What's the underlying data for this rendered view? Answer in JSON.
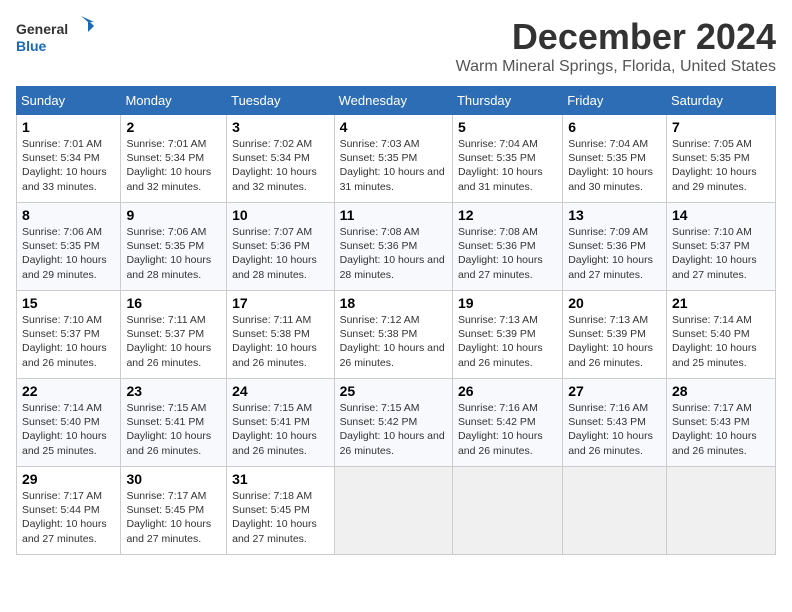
{
  "logo": {
    "line1": "General",
    "line2": "Blue"
  },
  "title": "December 2024",
  "subtitle": "Warm Mineral Springs, Florida, United States",
  "headers": [
    "Sunday",
    "Monday",
    "Tuesday",
    "Wednesday",
    "Thursday",
    "Friday",
    "Saturday"
  ],
  "weeks": [
    [
      {
        "day": "1",
        "sunrise": "Sunrise: 7:01 AM",
        "sunset": "Sunset: 5:34 PM",
        "daylight": "Daylight: 10 hours and 33 minutes."
      },
      {
        "day": "2",
        "sunrise": "Sunrise: 7:01 AM",
        "sunset": "Sunset: 5:34 PM",
        "daylight": "Daylight: 10 hours and 32 minutes."
      },
      {
        "day": "3",
        "sunrise": "Sunrise: 7:02 AM",
        "sunset": "Sunset: 5:34 PM",
        "daylight": "Daylight: 10 hours and 32 minutes."
      },
      {
        "day": "4",
        "sunrise": "Sunrise: 7:03 AM",
        "sunset": "Sunset: 5:35 PM",
        "daylight": "Daylight: 10 hours and 31 minutes."
      },
      {
        "day": "5",
        "sunrise": "Sunrise: 7:04 AM",
        "sunset": "Sunset: 5:35 PM",
        "daylight": "Daylight: 10 hours and 31 minutes."
      },
      {
        "day": "6",
        "sunrise": "Sunrise: 7:04 AM",
        "sunset": "Sunset: 5:35 PM",
        "daylight": "Daylight: 10 hours and 30 minutes."
      },
      {
        "day": "7",
        "sunrise": "Sunrise: 7:05 AM",
        "sunset": "Sunset: 5:35 PM",
        "daylight": "Daylight: 10 hours and 29 minutes."
      }
    ],
    [
      {
        "day": "8",
        "sunrise": "Sunrise: 7:06 AM",
        "sunset": "Sunset: 5:35 PM",
        "daylight": "Daylight: 10 hours and 29 minutes."
      },
      {
        "day": "9",
        "sunrise": "Sunrise: 7:06 AM",
        "sunset": "Sunset: 5:35 PM",
        "daylight": "Daylight: 10 hours and 28 minutes."
      },
      {
        "day": "10",
        "sunrise": "Sunrise: 7:07 AM",
        "sunset": "Sunset: 5:36 PM",
        "daylight": "Daylight: 10 hours and 28 minutes."
      },
      {
        "day": "11",
        "sunrise": "Sunrise: 7:08 AM",
        "sunset": "Sunset: 5:36 PM",
        "daylight": "Daylight: 10 hours and 28 minutes."
      },
      {
        "day": "12",
        "sunrise": "Sunrise: 7:08 AM",
        "sunset": "Sunset: 5:36 PM",
        "daylight": "Daylight: 10 hours and 27 minutes."
      },
      {
        "day": "13",
        "sunrise": "Sunrise: 7:09 AM",
        "sunset": "Sunset: 5:36 PM",
        "daylight": "Daylight: 10 hours and 27 minutes."
      },
      {
        "day": "14",
        "sunrise": "Sunrise: 7:10 AM",
        "sunset": "Sunset: 5:37 PM",
        "daylight": "Daylight: 10 hours and 27 minutes."
      }
    ],
    [
      {
        "day": "15",
        "sunrise": "Sunrise: 7:10 AM",
        "sunset": "Sunset: 5:37 PM",
        "daylight": "Daylight: 10 hours and 26 minutes."
      },
      {
        "day": "16",
        "sunrise": "Sunrise: 7:11 AM",
        "sunset": "Sunset: 5:37 PM",
        "daylight": "Daylight: 10 hours and 26 minutes."
      },
      {
        "day": "17",
        "sunrise": "Sunrise: 7:11 AM",
        "sunset": "Sunset: 5:38 PM",
        "daylight": "Daylight: 10 hours and 26 minutes."
      },
      {
        "day": "18",
        "sunrise": "Sunrise: 7:12 AM",
        "sunset": "Sunset: 5:38 PM",
        "daylight": "Daylight: 10 hours and 26 minutes."
      },
      {
        "day": "19",
        "sunrise": "Sunrise: 7:13 AM",
        "sunset": "Sunset: 5:39 PM",
        "daylight": "Daylight: 10 hours and 26 minutes."
      },
      {
        "day": "20",
        "sunrise": "Sunrise: 7:13 AM",
        "sunset": "Sunset: 5:39 PM",
        "daylight": "Daylight: 10 hours and 26 minutes."
      },
      {
        "day": "21",
        "sunrise": "Sunrise: 7:14 AM",
        "sunset": "Sunset: 5:40 PM",
        "daylight": "Daylight: 10 hours and 25 minutes."
      }
    ],
    [
      {
        "day": "22",
        "sunrise": "Sunrise: 7:14 AM",
        "sunset": "Sunset: 5:40 PM",
        "daylight": "Daylight: 10 hours and 25 minutes."
      },
      {
        "day": "23",
        "sunrise": "Sunrise: 7:15 AM",
        "sunset": "Sunset: 5:41 PM",
        "daylight": "Daylight: 10 hours and 26 minutes."
      },
      {
        "day": "24",
        "sunrise": "Sunrise: 7:15 AM",
        "sunset": "Sunset: 5:41 PM",
        "daylight": "Daylight: 10 hours and 26 minutes."
      },
      {
        "day": "25",
        "sunrise": "Sunrise: 7:15 AM",
        "sunset": "Sunset: 5:42 PM",
        "daylight": "Daylight: 10 hours and 26 minutes."
      },
      {
        "day": "26",
        "sunrise": "Sunrise: 7:16 AM",
        "sunset": "Sunset: 5:42 PM",
        "daylight": "Daylight: 10 hours and 26 minutes."
      },
      {
        "day": "27",
        "sunrise": "Sunrise: 7:16 AM",
        "sunset": "Sunset: 5:43 PM",
        "daylight": "Daylight: 10 hours and 26 minutes."
      },
      {
        "day": "28",
        "sunrise": "Sunrise: 7:17 AM",
        "sunset": "Sunset: 5:43 PM",
        "daylight": "Daylight: 10 hours and 26 minutes."
      }
    ],
    [
      {
        "day": "29",
        "sunrise": "Sunrise: 7:17 AM",
        "sunset": "Sunset: 5:44 PM",
        "daylight": "Daylight: 10 hours and 27 minutes."
      },
      {
        "day": "30",
        "sunrise": "Sunrise: 7:17 AM",
        "sunset": "Sunset: 5:45 PM",
        "daylight": "Daylight: 10 hours and 27 minutes."
      },
      {
        "day": "31",
        "sunrise": "Sunrise: 7:18 AM",
        "sunset": "Sunset: 5:45 PM",
        "daylight": "Daylight: 10 hours and 27 minutes."
      },
      null,
      null,
      null,
      null
    ]
  ]
}
